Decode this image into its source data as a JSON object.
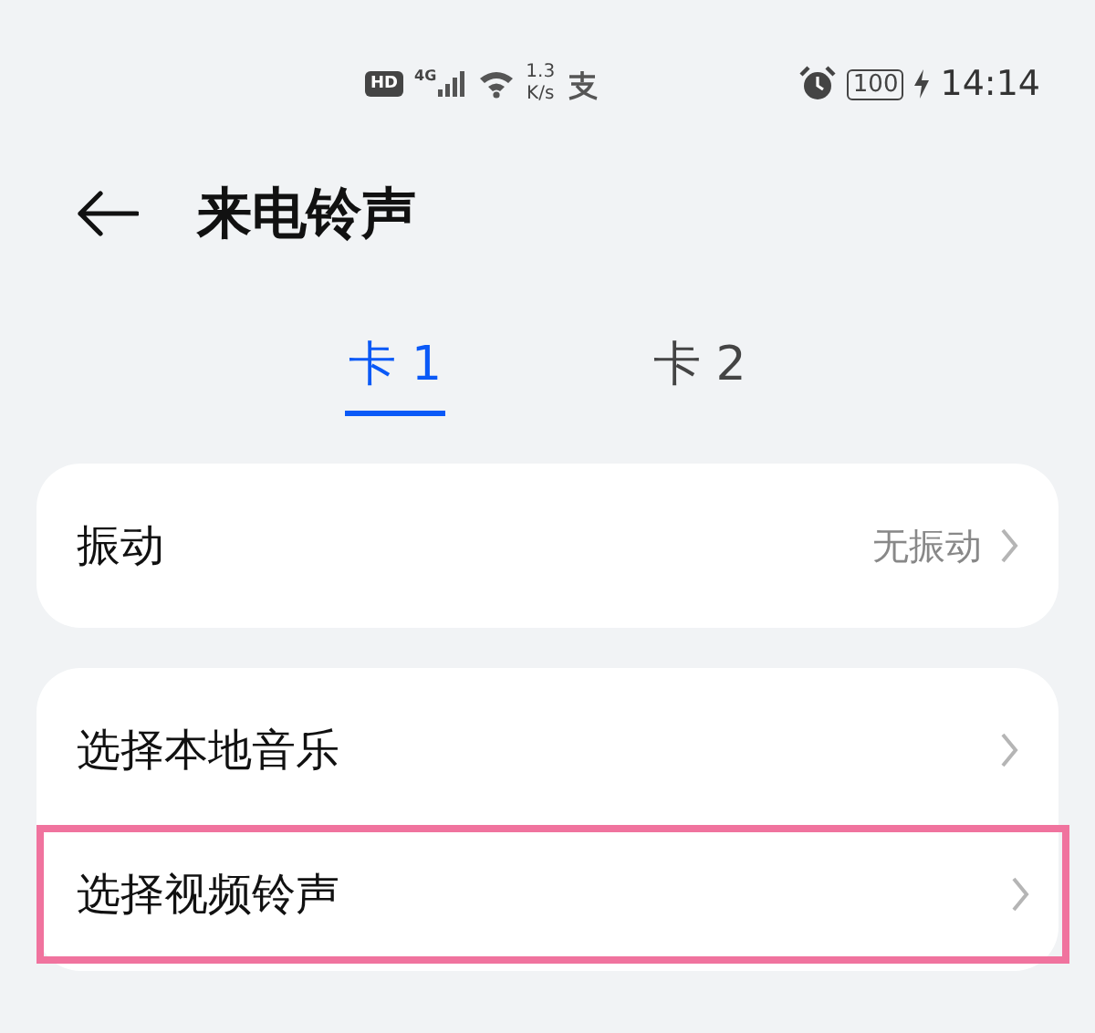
{
  "status_bar": {
    "hd": "HD",
    "network": "4G",
    "speed_value": "1.3",
    "speed_unit": "K/s",
    "battery": "100",
    "time": "14:14"
  },
  "header": {
    "title": "来电铃声"
  },
  "tabs": [
    {
      "label": "卡 1",
      "selected": true
    },
    {
      "label": "卡 2",
      "selected": false
    }
  ],
  "groups": [
    {
      "items": [
        {
          "label": "振动",
          "value": "无振动",
          "highlighted": false
        }
      ]
    },
    {
      "items": [
        {
          "label": "选择本地音乐",
          "highlighted": false
        },
        {
          "label": "选择视频铃声",
          "highlighted": true
        }
      ]
    }
  ]
}
